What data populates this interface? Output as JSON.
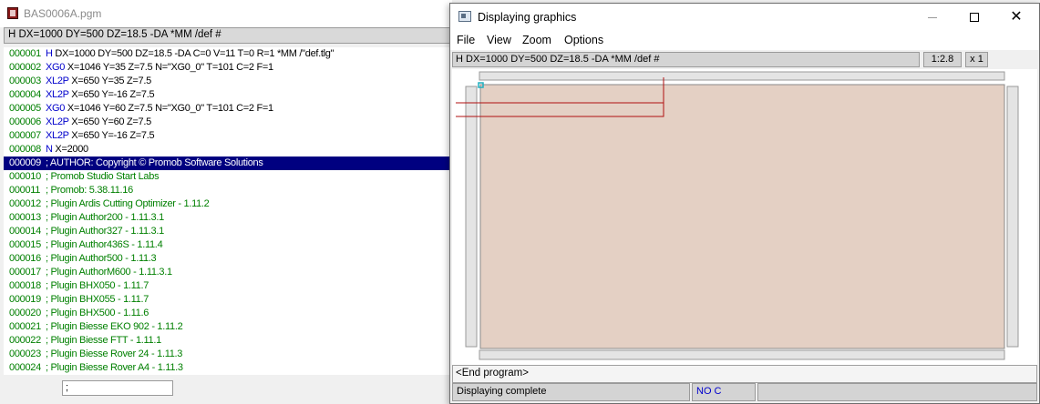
{
  "editor": {
    "title": "BAS0006A.pgm",
    "header": "H DX=1000 DY=500 DZ=18.5 -DA *MM /def #",
    "lines": [
      {
        "num": "000001",
        "kw": "H",
        "text": " DX=1000 DY=500 DZ=18.5 -DA C=0 V=11 T=0 R=1 *MM /\"def.tlg\"",
        "comment": false,
        "selected": false
      },
      {
        "num": "000002",
        "kw": "XG0",
        "text": " X=1046 Y=35 Z=7.5 N=\"XG0_0\" T=101 C=2 F=1",
        "comment": false,
        "selected": false
      },
      {
        "num": "000003",
        "kw": "XL2P",
        "text": " X=650 Y=35 Z=7.5",
        "comment": false,
        "selected": false
      },
      {
        "num": "000004",
        "kw": "XL2P",
        "text": " X=650 Y=-16 Z=7.5",
        "comment": false,
        "selected": false
      },
      {
        "num": "000005",
        "kw": "XG0",
        "text": " X=1046 Y=60 Z=7.5 N=\"XG0_0\" T=101 C=2 F=1",
        "comment": false,
        "selected": false
      },
      {
        "num": "000006",
        "kw": "XL2P",
        "text": " X=650 Y=60 Z=7.5",
        "comment": false,
        "selected": false
      },
      {
        "num": "000007",
        "kw": "XL2P",
        "text": " X=650 Y=-16 Z=7.5",
        "comment": false,
        "selected": false
      },
      {
        "num": "000008",
        "kw": "N",
        "text": " X=2000",
        "comment": false,
        "selected": false
      },
      {
        "num": "000009",
        "kw": "",
        "text": "; AUTHOR: Copyright © Promob Software Solutions",
        "comment": true,
        "selected": true
      },
      {
        "num": "000010",
        "kw": "",
        "text": "; Promob Studio Start Labs",
        "comment": true,
        "selected": false
      },
      {
        "num": "000011",
        "kw": "",
        "text": "; Promob: 5.38.11.16",
        "comment": true,
        "selected": false
      },
      {
        "num": "000012",
        "kw": "",
        "text": "; Plugin Ardis Cutting Optimizer - 1.11.2",
        "comment": true,
        "selected": false
      },
      {
        "num": "000013",
        "kw": "",
        "text": "; Plugin Author200 - 1.11.3.1",
        "comment": true,
        "selected": false
      },
      {
        "num": "000014",
        "kw": "",
        "text": "; Plugin Author327 - 1.11.3.1",
        "comment": true,
        "selected": false
      },
      {
        "num": "000015",
        "kw": "",
        "text": "; Plugin Author436S - 1.11.4",
        "comment": true,
        "selected": false
      },
      {
        "num": "000016",
        "kw": "",
        "text": "; Plugin Author500 - 1.11.3",
        "comment": true,
        "selected": false
      },
      {
        "num": "000017",
        "kw": "",
        "text": "; Plugin AuthorM600 - 1.11.3.1",
        "comment": true,
        "selected": false
      },
      {
        "num": "000018",
        "kw": "",
        "text": "; Plugin BHX050 - 1.11.7",
        "comment": true,
        "selected": false
      },
      {
        "num": "000019",
        "kw": "",
        "text": "; Plugin BHX055 - 1.11.7",
        "comment": true,
        "selected": false
      },
      {
        "num": "000020",
        "kw": "",
        "text": "; Plugin BHX500 - 1.11.6",
        "comment": true,
        "selected": false
      },
      {
        "num": "000021",
        "kw": "",
        "text": "; Plugin Biesse EKO 902 - 1.11.2",
        "comment": true,
        "selected": false
      },
      {
        "num": "000022",
        "kw": "",
        "text": "; Plugin Biesse FTT - 1.11.1",
        "comment": true,
        "selected": false
      },
      {
        "num": "000023",
        "kw": "",
        "text": "; Plugin Biesse Rover 24 - 1.11.3",
        "comment": true,
        "selected": false
      },
      {
        "num": "000024",
        "kw": "",
        "text": "; Plugin Biesse Rover A4 - 1.11.3",
        "comment": true,
        "selected": false
      }
    ],
    "input_value": ";"
  },
  "graphics": {
    "title": "Displaying graphics",
    "menu": [
      "File",
      "View",
      "Zoom",
      "Options"
    ],
    "command_header": "H DX=1000 DY=500 DZ=18.5 -DA *MM /def #",
    "scale": "1:2.8",
    "multiplier": "x 1",
    "command_line": "<End program>",
    "status": "Displaying complete",
    "mode": "NO C",
    "colors": {
      "panel_fill": "#e4d0c4",
      "frame_fill": "#e4e4e4",
      "toolpath": "#b01010",
      "origin_marker": "#20b0c0"
    }
  }
}
